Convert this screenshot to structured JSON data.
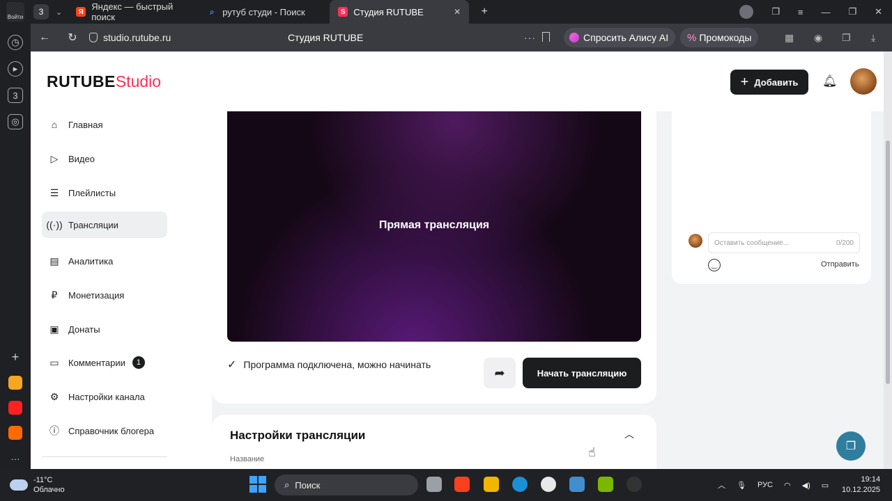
{
  "browser": {
    "tab_count": "3",
    "avatar_label": "Войти",
    "tabs": [
      {
        "label": "Яндекс — быстрый поиск",
        "favicon": "Я",
        "color": "#fc3f1d"
      },
      {
        "label": "рутуб студи - Поиск",
        "favicon": "search-icon",
        "color": "#4a7cff"
      },
      {
        "label": "Студия RUTUBE",
        "favicon": "S",
        "color": "#ff2d55"
      }
    ],
    "url": "studio.rutube.ru",
    "page_title": "Студия RUTUBE",
    "alice_label": "Спросить Алису AI",
    "promo_label": "Промокоды"
  },
  "header": {
    "logo_main": "RUTUBE",
    "logo_studio": "Studio",
    "add_label": "Добавить"
  },
  "sidebar": {
    "items": [
      {
        "label": "Главная",
        "icon": "home-icon"
      },
      {
        "label": "Видео",
        "icon": "video-icon"
      },
      {
        "label": "Плейлисты",
        "icon": "playlist-icon"
      },
      {
        "label": "Трансляции",
        "icon": "broadcast-icon",
        "active": true
      },
      {
        "label": "Аналитика",
        "icon": "analytics-icon"
      },
      {
        "label": "Монетизация",
        "icon": "monetization-icon"
      },
      {
        "label": "Донаты",
        "icon": "donate-icon"
      },
      {
        "label": "Комментарии",
        "icon": "comments-icon",
        "badge": "1"
      },
      {
        "label": "Настройки канала",
        "icon": "gear-icon"
      },
      {
        "label": "Справочник блогера",
        "icon": "info-icon"
      }
    ]
  },
  "stream": {
    "video_title": "Прямая трансляция",
    "status_text": "Программа подключена, можно начинать",
    "start_label": "Начать трансляцию"
  },
  "settings": {
    "title": "Настройки трансляции",
    "field_label": "Название"
  },
  "chat": {
    "placeholder": "Оставить сообщение...",
    "counter": "0/200",
    "send_label": "Отправить"
  },
  "taskbar": {
    "temperature": "-11°C",
    "weather": "Облачно",
    "search_label": "Поиск",
    "language": "РУС",
    "time": "19:14",
    "date": "10.12.2025"
  },
  "colors": {
    "accent": "#ff2d55",
    "dark_button": "#1c1d1f",
    "help_button": "#2f7e9e"
  }
}
